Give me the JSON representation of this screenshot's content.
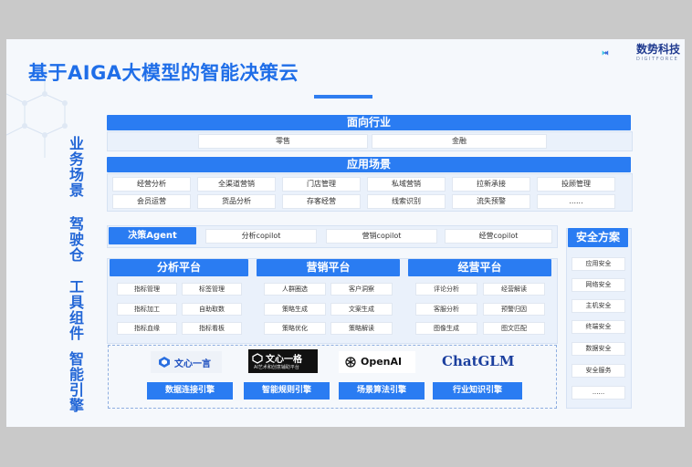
{
  "title": "基于AIGA大模型的智能决策云",
  "logo": {
    "name": "数势科技",
    "sub": "DIGITFORCE"
  },
  "side_labels": [
    "业务场景",
    "驾驶仓",
    "工具组件",
    "智能引擎"
  ],
  "industry": {
    "title": "面向行业",
    "items": [
      "零售",
      "金融"
    ]
  },
  "scenarios": {
    "title": "应用场景",
    "items": [
      "经营分析",
      "全渠道营销",
      "门店管理",
      "私域营销",
      "拉新承接",
      "投顾管理",
      "会员运营",
      "货品分析",
      "存客经营",
      "线索识别",
      "流失预警",
      "......"
    ]
  },
  "cockpit": {
    "agent": "决策Agent",
    "copilots": [
      "分析copilot",
      "营销copilot",
      "经营copilot"
    ]
  },
  "platforms": [
    {
      "title": "分析平台",
      "items": [
        "指标管理",
        "标签管理",
        "指标加工",
        "自助取数",
        "指标血缘",
        "指标看板"
      ]
    },
    {
      "title": "营销平台",
      "items": [
        "人群圈选",
        "客户洞察",
        "策略生成",
        "文案生成",
        "策略优化",
        "策略解读"
      ]
    },
    {
      "title": "经营平台",
      "items": [
        "评论分析",
        "经营解读",
        "客服分析",
        "预警归因",
        "图像生成",
        "图文匹配"
      ]
    }
  ],
  "models": {
    "wenxin_yiyan": "文心一言",
    "wenxin_yige": "文心一格",
    "wenxin_yige_sub": "AI艺术和创意辅助平台",
    "openai": "OpenAI",
    "chatglm": "ChatGLM"
  },
  "engines": [
    "数据连接引擎",
    "智能规则引擎",
    "场景算法引擎",
    "行业知识引擎"
  ],
  "security": {
    "title": "安全方案",
    "items": [
      "应用安全",
      "网络安全",
      "主机安全",
      "终端安全",
      "数据安全",
      "安全服务",
      "......"
    ]
  },
  "colors": {
    "primary": "#2a7cf2",
    "title": "#1f6ee8",
    "side": "#2266d6"
  }
}
